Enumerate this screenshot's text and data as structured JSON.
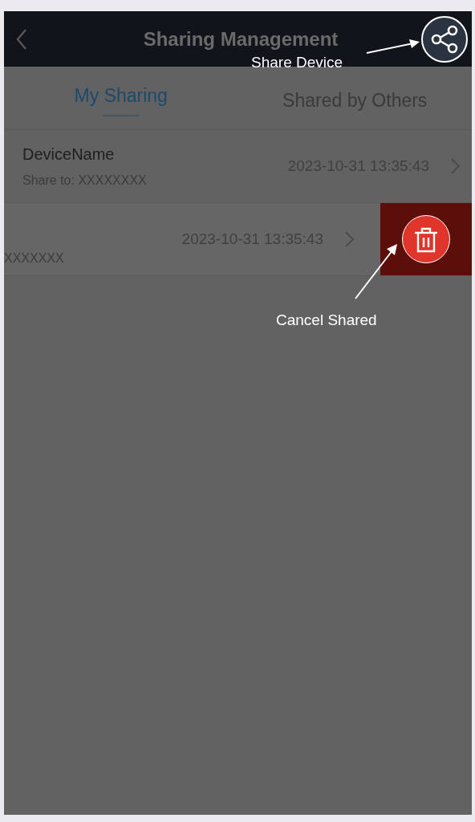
{
  "header": {
    "title": "Sharing Management"
  },
  "tabs": [
    {
      "label": "My Sharing",
      "selected": true
    },
    {
      "label": "Shared by Others",
      "selected": false
    }
  ],
  "shares": [
    {
      "device_name": "DeviceName",
      "share_to": "Share to: XXXXXXXX",
      "time": "2023-10-31 13:35:43",
      "swiped": false
    },
    {
      "share_to": "XXXXXXX",
      "time": "2023-10-31 13:35:43",
      "swiped": true
    }
  ],
  "annotations": [
    {
      "kind": "share",
      "text": "Share Device"
    },
    {
      "kind": "delete",
      "text": "Cancel Shared"
    }
  ]
}
